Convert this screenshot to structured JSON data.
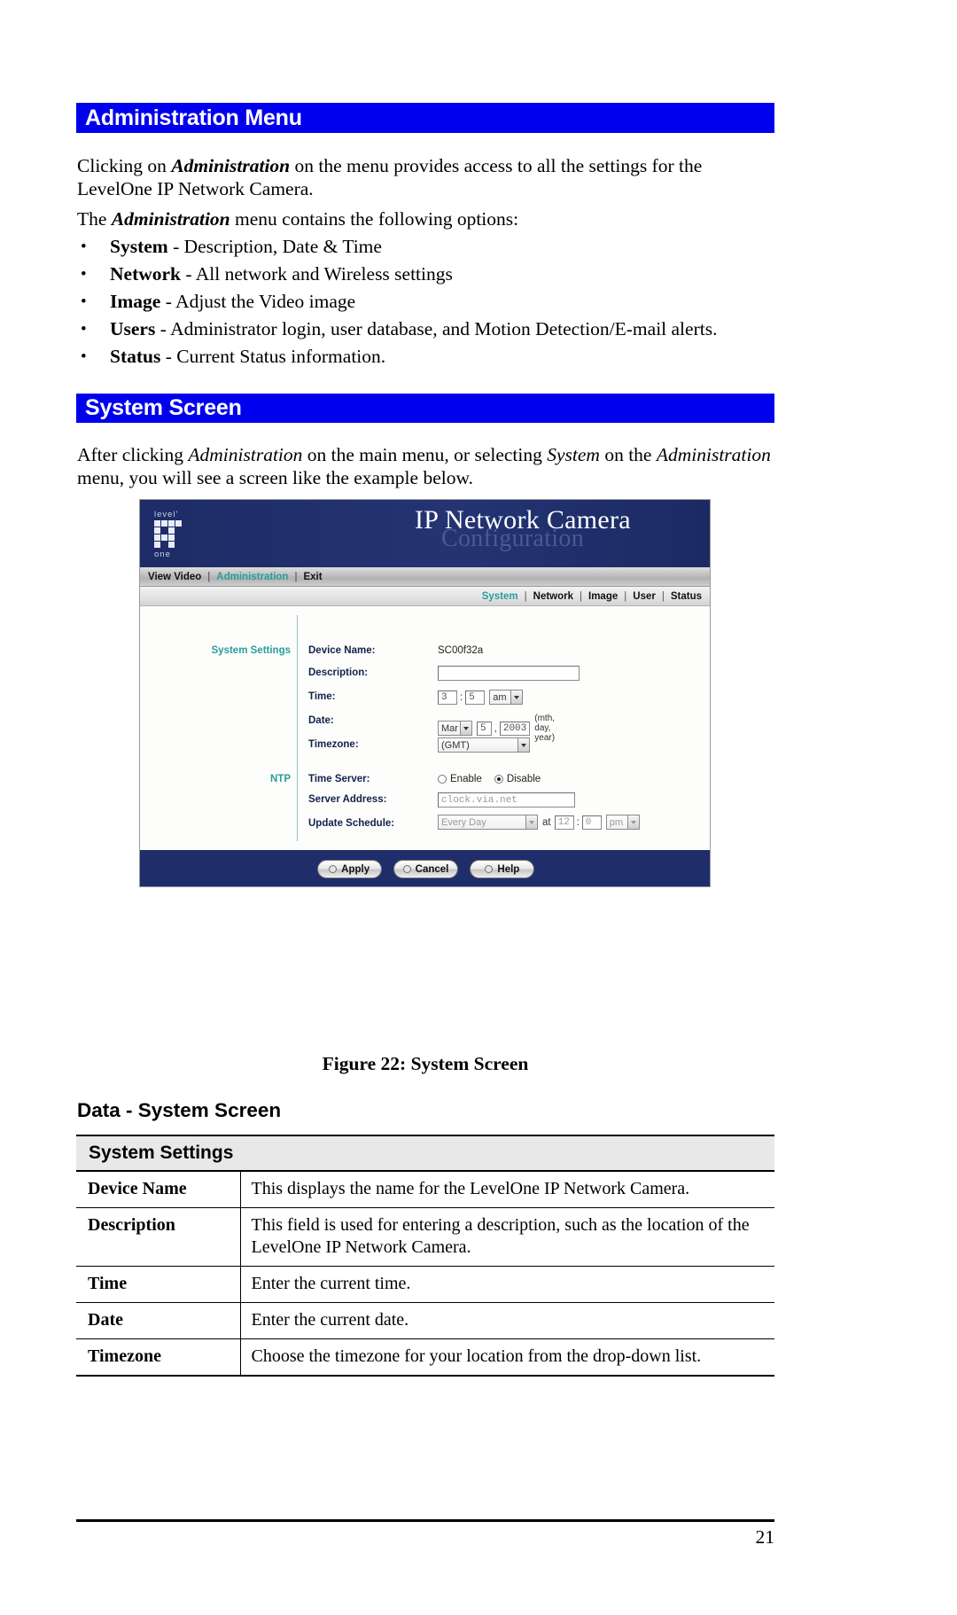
{
  "sections": {
    "admin_menu_title": "Administration Menu",
    "system_screen_title": "System Screen"
  },
  "paragraphs": {
    "p1_a": "Clicking on ",
    "p1_b": "Administration",
    "p1_c": " on the menu provides access to all the settings for the LevelOne IP Network Camera.",
    "p2_a": "The ",
    "p2_b": "Administration",
    "p2_c": " menu contains the following options:",
    "p3_a": "After clicking ",
    "p3_b": "Administration",
    "p3_c": " on the main menu, or selecting ",
    "p3_d": "System",
    "p3_e": " on the ",
    "p3_f": "Administration",
    "p3_g": " menu, you will see a screen like the example below."
  },
  "bullets": [
    {
      "dot": "•",
      "term": "System",
      "text": " - Description, Date & Time"
    },
    {
      "dot": "•",
      "term": "Network",
      "text": " - All network and Wireless settings"
    },
    {
      "dot": "•",
      "term": "Image",
      "text": " - Adjust the Video image"
    },
    {
      "dot": "•",
      "term": "Users",
      "text": " - Administrator login, user database, and Motion Detection/E-mail alerts."
    },
    {
      "dot": "•",
      "term": "Status",
      "text": " - Current Status information."
    }
  ],
  "figure": {
    "caption": "Figure 22: System Screen",
    "brand_top": "level'",
    "brand_bottom": "one",
    "title": "IP Network Camera",
    "subtitle": "Configuration",
    "nav_primary": [
      {
        "label": "View Video",
        "active": false
      },
      {
        "label": "Administration",
        "active": true
      },
      {
        "label": "Exit",
        "active": false
      }
    ],
    "nav_secondary": [
      {
        "label": "System",
        "active": true
      },
      {
        "label": "Network",
        "active": false
      },
      {
        "label": "Image",
        "active": false
      },
      {
        "label": "User",
        "active": false
      },
      {
        "label": "Status",
        "active": false
      }
    ],
    "separator": "|",
    "side_labels": {
      "system_settings": "System Settings",
      "ntp": "NTP"
    },
    "fields": {
      "device_name_label": "Device Name:",
      "device_name_value": "SC00f32a",
      "description_label": "Description:",
      "description_value": "",
      "time_label": "Time:",
      "time_hour": "3",
      "time_minute": "5",
      "time_ampm": "am",
      "time_colon": ":",
      "date_label": "Date:",
      "date_month": "Mar",
      "date_day": "5",
      "date_year": "2003",
      "date_comma": ",",
      "date_hint": "(mth, day, year)",
      "timezone_label": "Timezone:",
      "timezone_value": "(GMT)",
      "time_server_label": "Time Server:",
      "time_server_enable": "Enable",
      "time_server_disable": "Disable",
      "time_server_selected": "Disable",
      "server_address_label": "Server Address:",
      "server_address_value": "clock.via.net",
      "update_schedule_label": "Update Schedule:",
      "update_schedule_value": "Every Day",
      "update_at": "at",
      "update_hour": "12",
      "update_minute": "0",
      "update_colon": ":",
      "update_ampm": "pm"
    },
    "buttons": [
      {
        "label": "Apply"
      },
      {
        "label": "Cancel"
      },
      {
        "label": "Help"
      }
    ]
  },
  "data_section": {
    "heading": "Data - System Screen",
    "table_section_title": "System Settings",
    "rows": [
      {
        "key": "Device Name",
        "value": "This displays the name for the LevelOne IP Network Camera."
      },
      {
        "key": "Description",
        "value": "This field is used for entering a description, such as the location of the LevelOne IP Network Camera."
      },
      {
        "key": "Time",
        "value": "Enter the current time."
      },
      {
        "key": "Date",
        "value": "Enter the current date."
      },
      {
        "key": "Timezone",
        "value": "Choose the timezone for your location from the drop-down list."
      }
    ]
  },
  "footer": {
    "page_number": "21"
  },
  "colors": {
    "header_blue": "#0000ee",
    "browser_navy": "#1f2e6b",
    "accent_teal": "#2a9d9a"
  }
}
